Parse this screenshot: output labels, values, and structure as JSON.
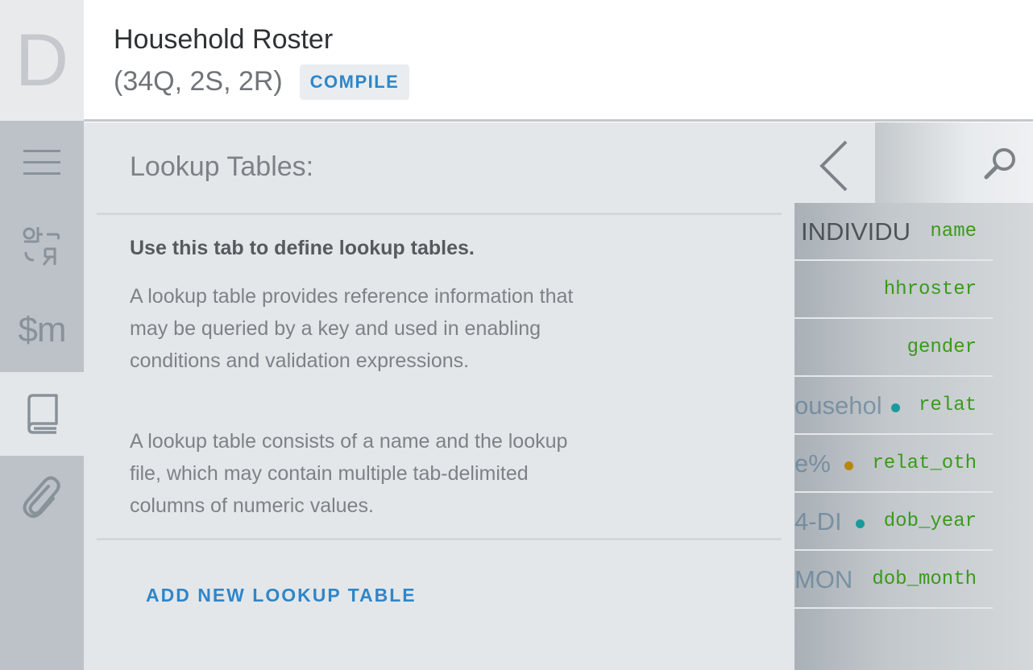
{
  "app": {
    "logo_letter": "D"
  },
  "header": {
    "title": "Household Roster",
    "subtitle": "(34Q, 2S, 2R)",
    "compile_label": "COMPILE"
  },
  "rail": {
    "items": [
      {
        "icon": "menu-icon"
      },
      {
        "icon": "translation-icon"
      },
      {
        "icon": "macros-icon",
        "label": "$m"
      },
      {
        "icon": "book-icon",
        "active": true
      },
      {
        "icon": "attachment-icon"
      }
    ]
  },
  "panel": {
    "title": "Lookup Tables:",
    "lead": "Use this tab to define lookup tables.",
    "paragraph1": "A lookup table provides reference information that may be queried by a key and used in enabling conditions and validation expressions.",
    "paragraph2": "A lookup table consists of a name and the lookup file, which may contain multiple tab-delimited columns of numeric values.",
    "add_label": "ADD NEW LOOKUP TABLE"
  },
  "variables": [
    {
      "label": "INDIVIDU",
      "name": "name",
      "dot": null
    },
    {
      "label": "",
      "name": "hhroster",
      "dot": null
    },
    {
      "label": "",
      "name": "gender",
      "dot": null
    },
    {
      "label": "ousehol",
      "name": "relat",
      "dot": "#1a9a9a"
    },
    {
      "label": "e%",
      "name": "relat_oth",
      "dot": "#b8860b"
    },
    {
      "label": "4-DI",
      "name": "dob_year",
      "dot": "#1a9a9a"
    },
    {
      "label": "MON",
      "name": "dob_month",
      "dot": null
    }
  ],
  "colors": {
    "accent": "#2f86c9",
    "variable_name": "#3a9a1a"
  }
}
